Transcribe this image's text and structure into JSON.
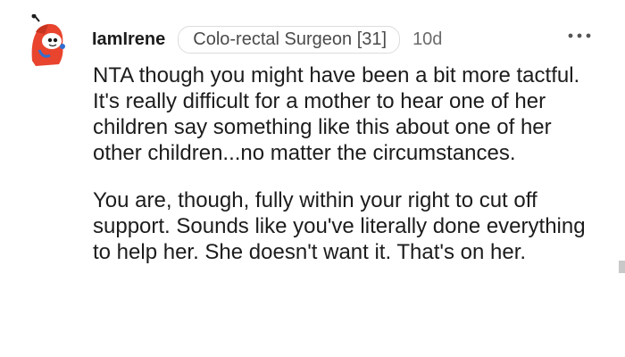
{
  "comment": {
    "author": "IamIrene",
    "flair": "Colo-rectal Surgeon [31]",
    "time": "10d",
    "more_icon": "more-horizontal-icon",
    "avatar_icon": "snoo-avatar-icon",
    "paragraphs": [
      "NTA though you might have been a bit more tactful. It's really difficult for a mother to hear one of her children say something like this about one of her other children...no matter the circumstances.",
      "You are, though, fully within your right to cut off support. Sounds like you've literally done everything to help her. She doesn't want it. That's on her."
    ]
  },
  "colors": {
    "avatar_red": "#e8442e",
    "text": "#1c1c1c",
    "meta": "#6b6b6b"
  }
}
